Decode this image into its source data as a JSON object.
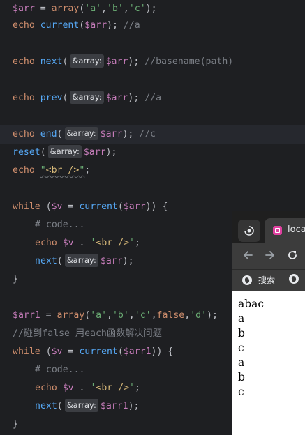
{
  "code": {
    "l1_var": "$arr",
    "l1_eq": " = ",
    "l1_fn": "array",
    "l1_args_open": "(",
    "l1_s1": "'a'",
    "l1_c1": ",",
    "l1_s2": "'b'",
    "l1_c2": ",",
    "l1_s3": "'c'",
    "l1_args_close": ");",
    "echo": "echo",
    "current": "current",
    "next": "next",
    "prev": "prev",
    "end": "end",
    "reset": "reset",
    "while": "while",
    "array": "array",
    "hint_array": "&array:",
    "arr": "$arr",
    "arr1": "$arr1",
    "v": "$v",
    "cmt_a": "//a",
    "cmt_basename": "//basename(path)",
    "cmt_c": "//c",
    "cmt_code": "# code...",
    "cmt_false": "//碰到false 用each函数解决问题",
    "br_open_quote": "\"",
    "br_tag": "<br />",
    "br_close_quote": "\";",
    "sq_open": "'",
    "sq_close": "';",
    "dot": " . ",
    "arr1_s1": "'a'",
    "arr1_s2": "'b'",
    "arr1_s3": "'c'",
    "arr1_false": "false",
    "arr1_s4": "'d'",
    "open_brace": "{",
    "close_brace": "}"
  },
  "browser": {
    "tab_title": "loca",
    "bookmark_label": "搜索",
    "output_lines": [
      "abac",
      "a",
      "b",
      "c",
      "a",
      "b",
      "c"
    ]
  },
  "colors": {
    "editor_bg": "#1e1f22",
    "keyword": "#cf8e6d",
    "function": "#56a8f5",
    "variable": "#c77dbb",
    "string": "#6aab73",
    "comment": "#7a7e85"
  }
}
